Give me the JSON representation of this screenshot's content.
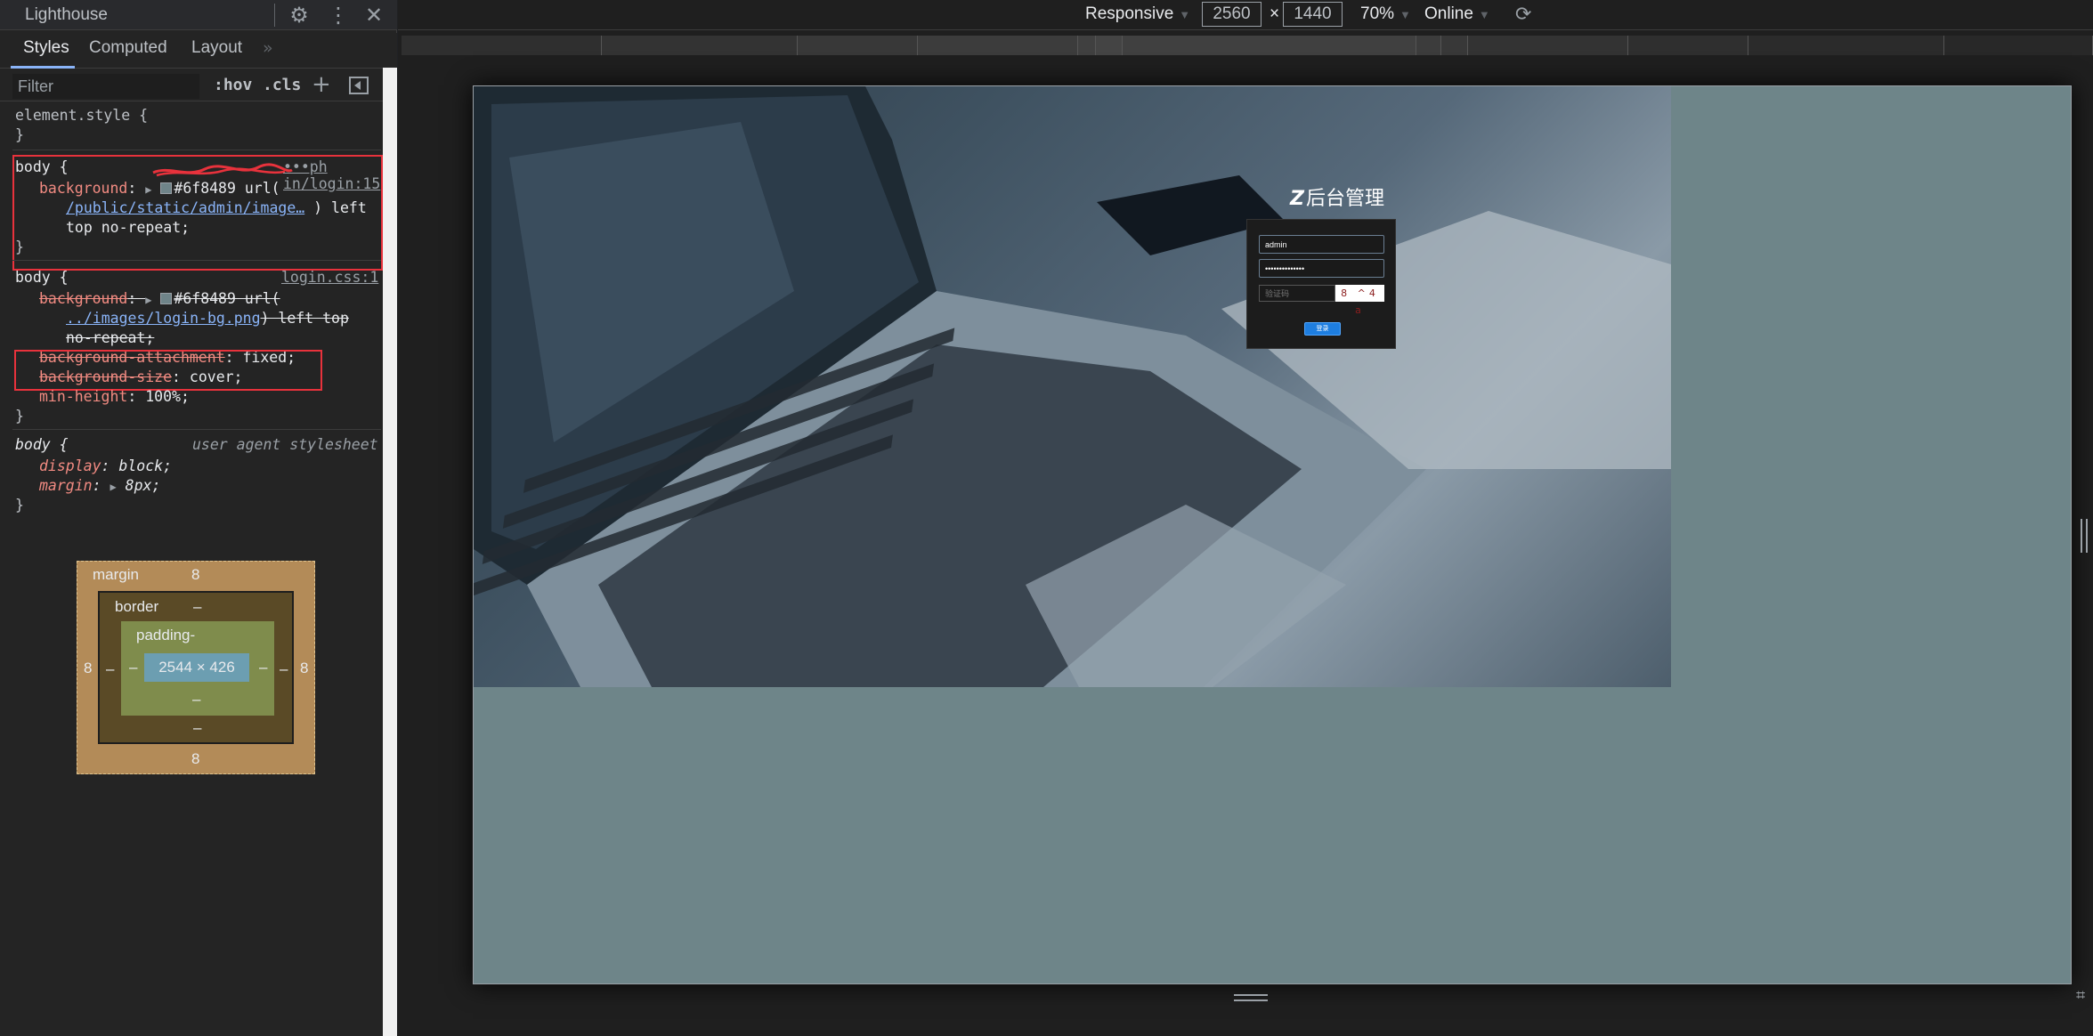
{
  "devtools": {
    "panel_title": "Lighthouse",
    "tabs": [
      {
        "label": "Styles"
      },
      {
        "label": "Computed"
      },
      {
        "label": "Layout"
      }
    ],
    "tabs_more": "»",
    "filter": {
      "placeholder": "Filter",
      "hov": ":hov",
      "cls": ".cls",
      "plus": "+"
    },
    "rules": {
      "element_style": {
        "selector": "element.style {",
        "close": "}"
      },
      "rule1": {
        "selector": "body {",
        "source": "•••ph in/login:15",
        "prop": "background",
        "swatch_color": "#6f8489",
        "value_start": "#6f8489 url(",
        "link": "/public/static/admin/image…",
        "value_end": ") left",
        "value_line3": "top no-repeat;",
        "close": "}"
      },
      "rule2": {
        "selector": "body {",
        "source": "login.css:1",
        "prop_bg": "background",
        "bg_value_start": "#6f8489 url(",
        "bg_link": "../images/login-bg.png",
        "bg_value_end": ") left top",
        "bg_value_line3": "no-repeat;",
        "prop_attach": "background-attachment",
        "attach_value": "fixed;",
        "prop_size": "background-size",
        "size_value": "cover;",
        "prop_minh": "min-height",
        "minh_value": "100%;",
        "close": "}"
      },
      "rule3": {
        "selector": "body {",
        "source": "user agent stylesheet",
        "prop_display": "display",
        "display_value": "block;",
        "prop_margin": "margin",
        "margin_value": "8px;",
        "close": "}"
      }
    },
    "box_model": {
      "margin_label": "margin",
      "margin_top": "8",
      "margin_bottom": "8",
      "margin_left": "8",
      "margin_right": "8",
      "border_label": "border",
      "border_top": "–",
      "border_bottom": "–",
      "border_left": "–",
      "border_right": "–",
      "padding_label": "padding-",
      "padding_bottom": "–",
      "padding_left": "–",
      "padding_right": "–",
      "content_size": "2544 × 426"
    }
  },
  "device_toolbar": {
    "mode": "Responsive",
    "width": "2560",
    "times": "×",
    "height": "1440",
    "zoom": "70%",
    "network": "Online"
  },
  "page": {
    "bg_color": "#6f8489",
    "logo_mark": "Z",
    "logo_text": "后台管理",
    "username_value": "admin",
    "password_value": "••••••••••••••",
    "captcha_placeholder": "验证码",
    "captcha_text": "8 ^4 a",
    "login_button": "登录"
  }
}
